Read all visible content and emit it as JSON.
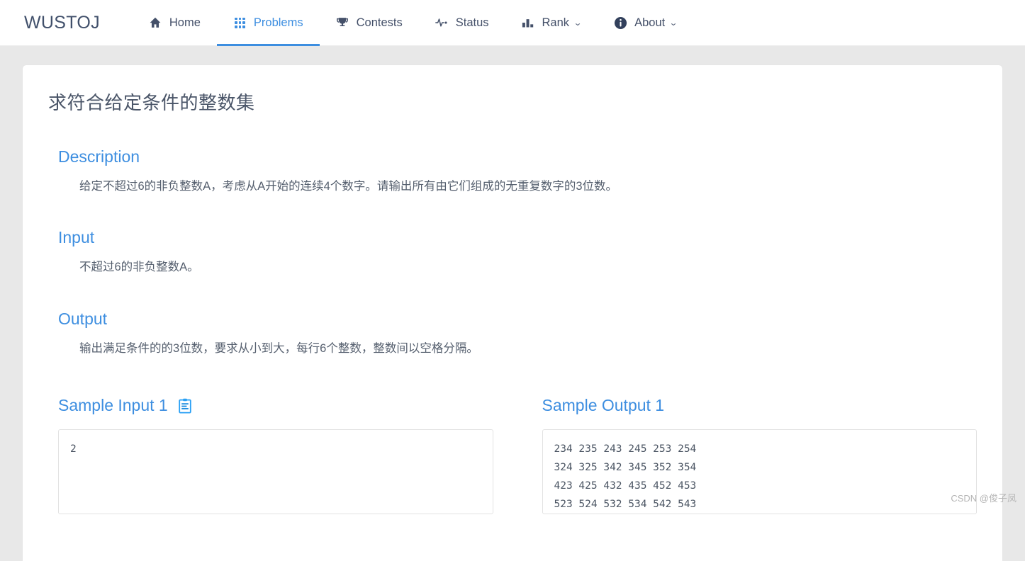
{
  "navbar": {
    "brand": "WUSTOJ",
    "items": [
      {
        "label": "Home",
        "icon": "home-icon",
        "active": false,
        "caret": ""
      },
      {
        "label": "Problems",
        "icon": "grid-dots-icon",
        "active": true,
        "caret": ""
      },
      {
        "label": "Contests",
        "icon": "trophy-icon",
        "active": false,
        "caret": ""
      },
      {
        "label": "Status",
        "icon": "pulse-icon",
        "active": false,
        "caret": ""
      },
      {
        "label": "Rank",
        "icon": "bar-chart-icon",
        "active": false,
        "caret": "⌄"
      },
      {
        "label": "About",
        "icon": "info-circle-icon",
        "active": false,
        "caret": "⌄"
      }
    ]
  },
  "problem": {
    "title": "求符合给定条件的整数集",
    "sections": [
      {
        "heading": "Description",
        "body": "给定不超过6的非负整数A，考虑从A开始的连续4个数字。请输出所有由它们组成的无重复数字的3位数。"
      },
      {
        "heading": "Input",
        "body": "不超过6的非负整数A。"
      },
      {
        "heading": "Output",
        "body": "输出满足条件的的3位数，要求从小到大，每行6个整数，整数间以空格分隔。"
      }
    ],
    "sample_input": {
      "heading": "Sample Input 1",
      "copy_icon": "clipboard-copy-icon",
      "content": "2"
    },
    "sample_output": {
      "heading": "Sample Output 1",
      "content": "234 235 243 245 253 254\n324 325 342 345 352 354\n423 425 432 435 452 453\n523 524 532 534 542 543"
    }
  },
  "watermark": "CSDN @俊子凤",
  "colors": {
    "accent": "#3d8ee0",
    "text_dark": "#445069",
    "body_text": "#555f6e",
    "page_bg": "#e8e8e8",
    "card_bg": "#ffffff",
    "border": "#e2e2e2"
  }
}
